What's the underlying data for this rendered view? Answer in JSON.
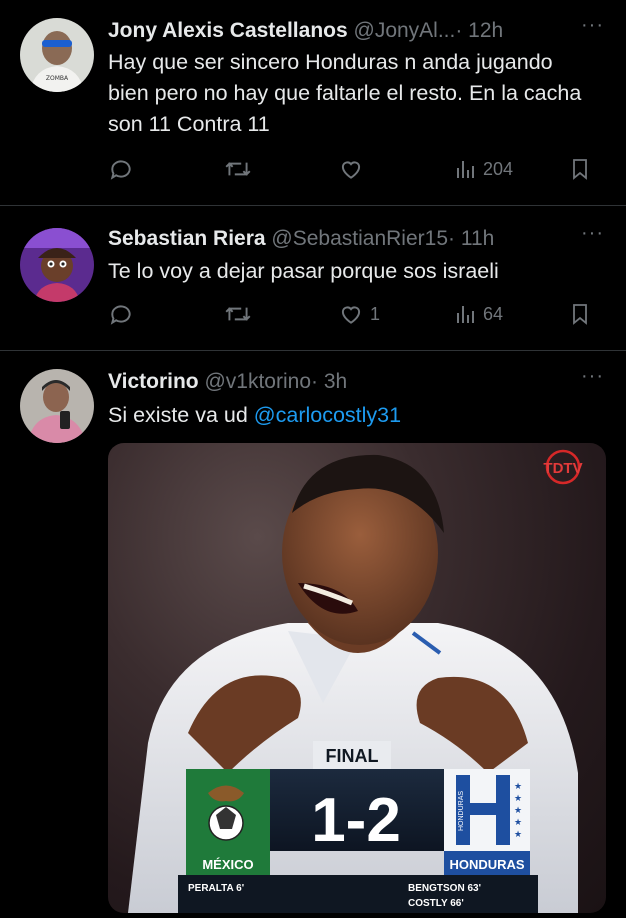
{
  "tweets": [
    {
      "name": "Jony Alexis Castellanos",
      "handle": "@JonyAl...",
      "time": "· 12h",
      "text": "Hay que ser sincero Honduras n anda jugando bien pero no hay que faltarle el resto. En la cacha son 11 Contra 11",
      "views": "204",
      "likes": "",
      "retweets": "",
      "replies": ""
    },
    {
      "name": "Sebastian Riera",
      "handle": "@SebastianRier15",
      "time": "· 11h",
      "text": "Te lo voy a dejar pasar porque sos israeli",
      "views": "64",
      "likes": "1",
      "retweets": "",
      "replies": ""
    },
    {
      "name": "Victorino",
      "handle": "@v1ktorino",
      "time": "· 3h",
      "text_prefix": "Si existe va ud ",
      "mention": "@carlocostly31"
    }
  ],
  "media": {
    "watermark": "TDTV",
    "badge": "FINAL",
    "score": "1-2",
    "team_home": "MÉXICO",
    "team_away": "HONDURAS",
    "crest_away_label": "HONDURAS",
    "scorers_home": [
      "PERALTA 6'"
    ],
    "scorers_away": [
      "BENGTSON 63'",
      "COSTLY 66'"
    ]
  },
  "colors": {
    "background": "#000000",
    "divider": "#2f3336",
    "text": "#e7e9ea",
    "muted": "#71767b",
    "link": "#1d9bf0",
    "mexico_green": "#1f7a3a",
    "honduras_blue": "#1e4fa0"
  },
  "icons": [
    "reply-icon",
    "retweet-icon",
    "like-icon",
    "views-icon",
    "bookmark-icon",
    "more-icon"
  ]
}
